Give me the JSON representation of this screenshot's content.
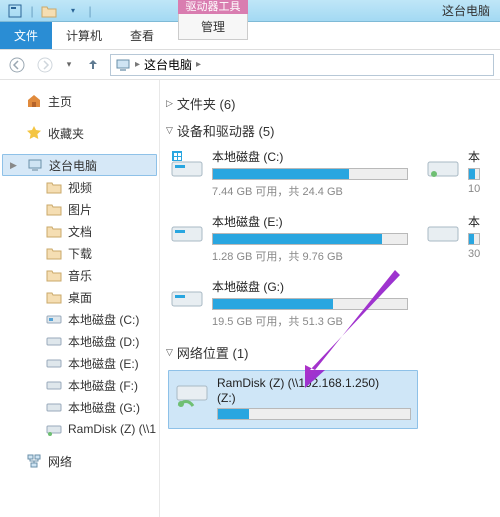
{
  "colors": {
    "accent": "#2a8dd4",
    "bar_fill": "#29a6e0",
    "context_head": "#d97db0",
    "selection_bg": "#cfe6f7"
  },
  "titlebar": {
    "app_title": "这台电脑",
    "context_head": "驱动器工具"
  },
  "ribbon": {
    "file": "文件",
    "tabs": [
      "计算机",
      "查看"
    ],
    "context_tab": "管理"
  },
  "address": {
    "location": "这台电脑"
  },
  "sidebar": {
    "home": "主页",
    "favorites": "收藏夹",
    "this_pc": "这台电脑",
    "items": [
      {
        "label": "视频"
      },
      {
        "label": "图片"
      },
      {
        "label": "文档"
      },
      {
        "label": "下载"
      },
      {
        "label": "音乐"
      },
      {
        "label": "桌面"
      },
      {
        "label": "本地磁盘 (C:)"
      },
      {
        "label": "本地磁盘 (D:)"
      },
      {
        "label": "本地磁盘 (E:)"
      },
      {
        "label": "本地磁盘 (F:)"
      },
      {
        "label": "本地磁盘 (G:)"
      },
      {
        "label": "RamDisk (Z) (\\\\1"
      }
    ],
    "network": "网络"
  },
  "sections": {
    "folders": "文件夹 (6)",
    "devices": "设备和驱动器 (5)",
    "network": "网络位置 (1)"
  },
  "drives": [
    {
      "name": "本地磁盘 (C:)",
      "free": "7.44 GB",
      "total": "24.4 GB",
      "fill_pct": 70,
      "badge": "win"
    },
    {
      "name": "本地磁盘 (E:)",
      "free": "1.28 GB",
      "total": "9.76 GB",
      "fill_pct": 87
    },
    {
      "name": "本地磁盘 (G:)",
      "free": "19.5 GB",
      "total": "51.3 GB",
      "fill_pct": 62
    }
  ],
  "drives_right": [
    {
      "name_partial": "本",
      "stats_partial": "10"
    },
    {
      "name_partial": "本",
      "stats_partial": "30"
    }
  ],
  "labels": {
    "free_word": "可用",
    "sep_word": "，共 "
  },
  "network_loc": {
    "title": "RamDisk (Z) (\\\\192.168.1.250)",
    "sub": "(Z:)",
    "fill_pct": 16
  }
}
